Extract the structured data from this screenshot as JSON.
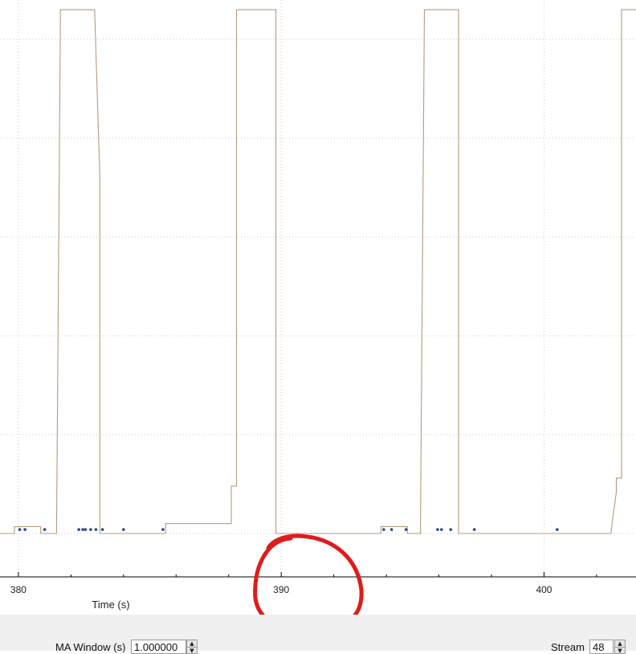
{
  "chart_data": {
    "type": "line",
    "xlabel": "Time (s)",
    "ylabel": "",
    "xlim": [
      379.3,
      403.5
    ],
    "ylim": [
      -0.15,
      5.25
    ],
    "x_ticks": [
      380,
      390,
      400
    ],
    "x_tick_labels": [
      "380",
      "390",
      "400"
    ],
    "grid": true,
    "series": [
      {
        "color": "#b49c7c",
        "points": [
          [
            379.3,
            0
          ],
          [
            379.85,
            0
          ],
          [
            379.85,
            0.07
          ],
          [
            380.85,
            0.07
          ],
          [
            380.85,
            0
          ],
          [
            381.45,
            0
          ],
          [
            381.6,
            5.3
          ],
          [
            382.9,
            5.3
          ],
          [
            383.1,
            3.6
          ],
          [
            383.1,
            0
          ],
          [
            384.7,
            0
          ],
          [
            385.6,
            0
          ],
          [
            385.6,
            0.1
          ],
          [
            387.0,
            0.1
          ],
          [
            388.1,
            0.1
          ],
          [
            388.1,
            0.48
          ],
          [
            388.3,
            0.48
          ],
          [
            388.3,
            5.3
          ],
          [
            389.8,
            5.3
          ],
          [
            389.8,
            0
          ],
          [
            393.8,
            0
          ],
          [
            393.8,
            0.07
          ],
          [
            394.8,
            0.07
          ],
          [
            394.8,
            0
          ],
          [
            395.3,
            0
          ],
          [
            395.3,
            0.09
          ],
          [
            395.45,
            5.3
          ],
          [
            396.75,
            5.3
          ],
          [
            396.75,
            0
          ],
          [
            402.55,
            0
          ],
          [
            402.6,
            0.12
          ],
          [
            402.75,
            0.42
          ],
          [
            402.75,
            0.56
          ],
          [
            402.95,
            0.56
          ],
          [
            402.95,
            5.3
          ],
          [
            403.5,
            5.3
          ]
        ]
      },
      {
        "color": "#2f4f8a",
        "markers_only": true,
        "points": [
          [
            380.05,
            0.04
          ],
          [
            380.25,
            0.04
          ],
          [
            381.0,
            0.04
          ],
          [
            382.3,
            0.04
          ],
          [
            382.45,
            0.04
          ],
          [
            382.55,
            0.04
          ],
          [
            382.75,
            0.04
          ],
          [
            382.95,
            0.04
          ],
          [
            383.2,
            0.04
          ],
          [
            384.0,
            0.04
          ],
          [
            385.5,
            0.04
          ],
          [
            393.9,
            0.04
          ],
          [
            394.2,
            0.04
          ],
          [
            394.75,
            0.04
          ],
          [
            395.95,
            0.04
          ],
          [
            396.1,
            0.04
          ],
          [
            396.45,
            0.04
          ],
          [
            397.35,
            0.04
          ],
          [
            400.5,
            0.04
          ]
        ]
      }
    ]
  },
  "controls": {
    "ma_window_label": "MA Window (s)",
    "ma_window_value": "1.000000",
    "stream_label": "Stream",
    "stream_value": "48",
    "spin_up_glyph": "▲",
    "spin_down_glyph": "▼"
  },
  "annotation": {
    "color": "#e01b1b"
  }
}
